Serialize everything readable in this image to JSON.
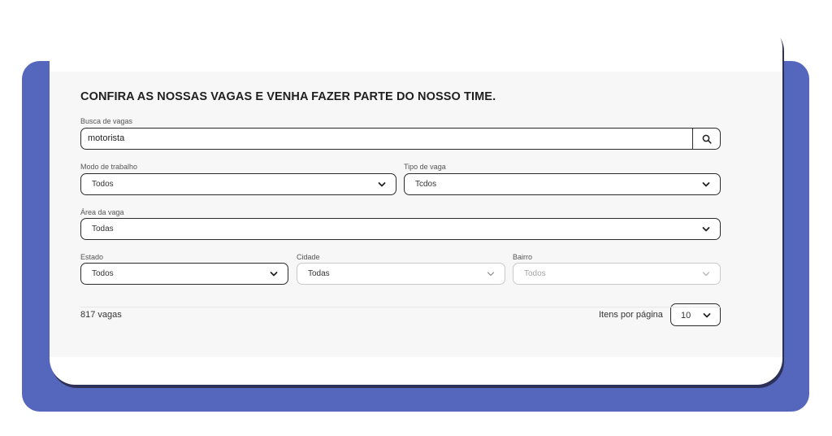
{
  "page": {
    "title": "CONFIRA AS NOSSAS VAGAS E VENHA FAZER PARTE DO NOSSO TIME."
  },
  "search": {
    "label": "Busca de vagas",
    "value": "motorista"
  },
  "filters": {
    "modo_trabalho": {
      "label": "Modo de trabalho",
      "value": "Todos"
    },
    "tipo_vaga": {
      "label": "Tipo de vaga",
      "value": "Tcdos"
    },
    "area_vaga": {
      "label": "Área da vaga",
      "value": "Todas"
    },
    "estado": {
      "label": "Estado",
      "value": "Todos"
    },
    "cidade": {
      "label": "Cidade",
      "value": "Todas"
    },
    "bairro": {
      "label": "Bairro",
      "value": "Todos"
    }
  },
  "results": {
    "count_text": "817 vagas",
    "per_page_label": "Itens por página",
    "per_page_value": "10"
  },
  "colors": {
    "backdrop": "#5566bd",
    "card_border": "#2e3157",
    "panel": "#f7f7f7"
  },
  "icons": {
    "search": "search-icon",
    "chevron": "chevron-down-icon"
  }
}
